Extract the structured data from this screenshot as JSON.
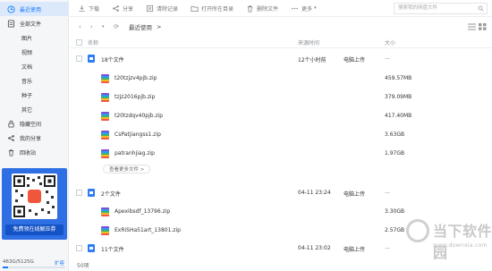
{
  "sidebar": {
    "items": [
      {
        "label": "最近使用",
        "icon": "clock-icon",
        "active": true
      },
      {
        "label": "全部文件",
        "icon": "file-icon",
        "active": false
      },
      {
        "label": "图片",
        "sub": true
      },
      {
        "label": "视频",
        "sub": true
      },
      {
        "label": "文档",
        "sub": true
      },
      {
        "label": "音乐",
        "sub": true
      },
      {
        "label": "种子",
        "sub": true
      },
      {
        "label": "其它",
        "sub": true
      },
      {
        "label": "隐藏空间",
        "icon": "lock-icon"
      },
      {
        "label": "我的分享",
        "icon": "share-icon"
      },
      {
        "label": "回收站",
        "icon": "trash-icon"
      }
    ],
    "promo_label": "免费领在线解压券",
    "storage_text": "463G/5125G",
    "storage_fraction": 0.09,
    "expand_label": "扩容"
  },
  "toolbar": {
    "download": "下载",
    "share": "分享",
    "delete_record": "清除记录",
    "open_folder": "打开所在目录",
    "delete_file": "删除文件",
    "more": "更多",
    "search_placeholder": "搜索我的网盘文件"
  },
  "breadcrumb": {
    "current": "最近使用",
    "sep": ">"
  },
  "table": {
    "headers": {
      "name": "名称",
      "time": "来源时间",
      "size": "大小"
    }
  },
  "groups": [
    {
      "title": "18个文件",
      "time": "12个小时前",
      "source": "电脑上传",
      "size": "—",
      "files": [
        {
          "name": "t20tzjzv4pjb.zip",
          "size": "459.57MB"
        },
        {
          "name": "tzjz2016pjb.zip",
          "size": "379.09MB"
        },
        {
          "name": "t20tzdqv40pjb.zip",
          "size": "417.40MB"
        },
        {
          "name": "CsPatjiangss1.zip",
          "size": "3.63GB"
        },
        {
          "name": "patranhjiag.zip",
          "size": "1.97GB"
        }
      ],
      "more_label": "查看更多文件 >"
    },
    {
      "title": "2个文件",
      "time": "04-11 23:24",
      "source": "电脑上传",
      "size": "—",
      "files": [
        {
          "name": "Apexibsdf_13796.zip",
          "size": "3.30GB"
        },
        {
          "name": "ExRiSHa51art_13801.zip",
          "size": "2.57GB"
        }
      ]
    },
    {
      "title": "11个文件",
      "time": "04-11 23:02",
      "source": "电脑上传",
      "size": "—"
    }
  ],
  "status": {
    "count": "50项"
  },
  "watermark": {
    "text": "当下软件园",
    "url": "www.downxia.com"
  },
  "colors": {
    "accent": "#1677ff",
    "folder": "#2e7df6",
    "promo": "#2f6fe4"
  }
}
